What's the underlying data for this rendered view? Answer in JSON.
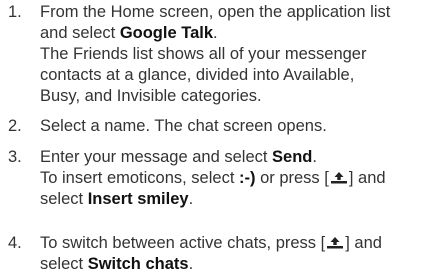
{
  "steps": [
    {
      "number": "1.",
      "line1_prefix": "From the Home screen, open the application list",
      "line2_prefix": "and select ",
      "line2_bold": "Google Talk",
      "line2_suffix": ".",
      "note_line1": "The Friends list shows all of your messenger",
      "note_line2": "contacts at a glance, divided into Available,",
      "note_line3": "Busy, and Invisible categories."
    },
    {
      "number": "2.",
      "text": "Select a name. The chat screen opens."
    },
    {
      "number": "3.",
      "line1_prefix": "Enter your message and select ",
      "line1_bold": "Send",
      "line1_suffix": ".",
      "line2_prefix": "To insert emoticons, select ",
      "line2_bold": ":-)",
      "line2_middle": " or press [",
      "line2_suffix": "] and",
      "line3_prefix": "select ",
      "line3_bold": "Insert smiley",
      "line3_suffix": "."
    },
    {
      "number": "4.",
      "line1_prefix": "To switch between active chats, press [",
      "line1_suffix": "] and",
      "line2_prefix": "select ",
      "line2_bold": "Switch chats",
      "line2_suffix": "."
    }
  ],
  "icons": {
    "menu_key": "menu-key-icon"
  },
  "colors": {
    "text": "#333333",
    "bold_text": "#111111"
  }
}
